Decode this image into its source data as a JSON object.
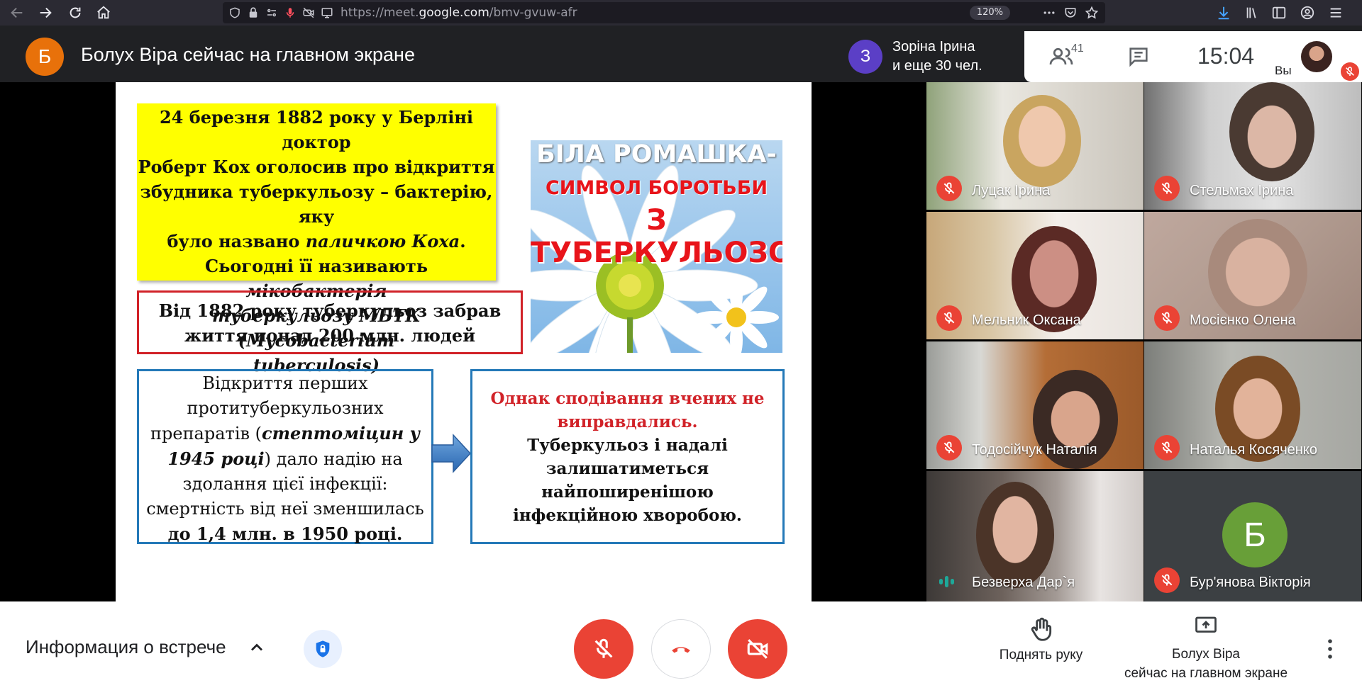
{
  "browser": {
    "url_prefix": "https://meet.",
    "url_domain": "google.com",
    "url_path": "/bmv-gvuw-afr",
    "zoom": "120%"
  },
  "meet": {
    "presenter_initial": "Б",
    "presenting_title": "Болух Віра сейчас на главном экране",
    "owner_initial": "З",
    "owner_line1": "Зоріна Ірина",
    "owner_line2": "и еще 30 чел.",
    "participants_count": "41",
    "time": "15:04",
    "self_label": "Вы"
  },
  "slide": {
    "yellow_lines": [
      "24 березня 1882 року у Берліні доктор",
      "Роберт Кох оголосив про відкриття",
      "збудника туберкульозу – бактерію, яку",
      "було названо ",
      "паличкою Коха",
      ".",
      "Сьогодні її називають ",
      "мікобактерія",
      "туберкульозу МБТК (Mycobacterium",
      "tuberculosis)"
    ],
    "image_line1": "БІЛА РОМАШКА-",
    "image_line2": "СИМВОЛ БОРОТЬБИ",
    "image_line3": "З ТУБЕРКУЛЬОЗОМ",
    "red_box_line1": "Від 1882 року туберкульоз забрав",
    "red_box_line2": "життя понад 200 млн. людей",
    "left_box": [
      "Відкриття перших",
      "протитуберкульозних",
      "препаратів (",
      "стептоміцин у",
      "1945 році",
      ") дало надію на",
      "здолання цієї інфекції:",
      "смертність від неї зменшилась",
      "до 1,4 млн. в 1950 році."
    ],
    "right_box_red": "Однак сподівання вчених не виправдались.",
    "right_box_black": "Туберкульоз і надалі залишатиметься найпоширенішою інфекційною хворобою."
  },
  "participants": [
    {
      "name": "Луцак Ірина",
      "muted": true
    },
    {
      "name": "Стельмах Ірина",
      "muted": true
    },
    {
      "name": "Мельник Оксана",
      "muted": true
    },
    {
      "name": "Мосієнко Олена",
      "muted": true
    },
    {
      "name": "Тодосійчук Наталія",
      "muted": true
    },
    {
      "name": "Наталья Косяченко",
      "muted": true
    },
    {
      "name": "Безверха Дар`я",
      "muted": false,
      "speaking": true
    },
    {
      "name": "Бур'янова Вікторія",
      "muted": true,
      "initial": "Б"
    }
  ],
  "bottom": {
    "meeting_info": "Информация о встрече",
    "raise_hand": "Поднять руку",
    "present_line1": "Болух Віра",
    "present_line2": "сейчас на главном экране"
  },
  "colors": {
    "mute_red": "#ea4335",
    "presenter_avatar": "#e8710a",
    "owner_avatar": "#5b3fc6",
    "participant_avatar": "#689f38",
    "slide_yellow": "#ffff00"
  }
}
